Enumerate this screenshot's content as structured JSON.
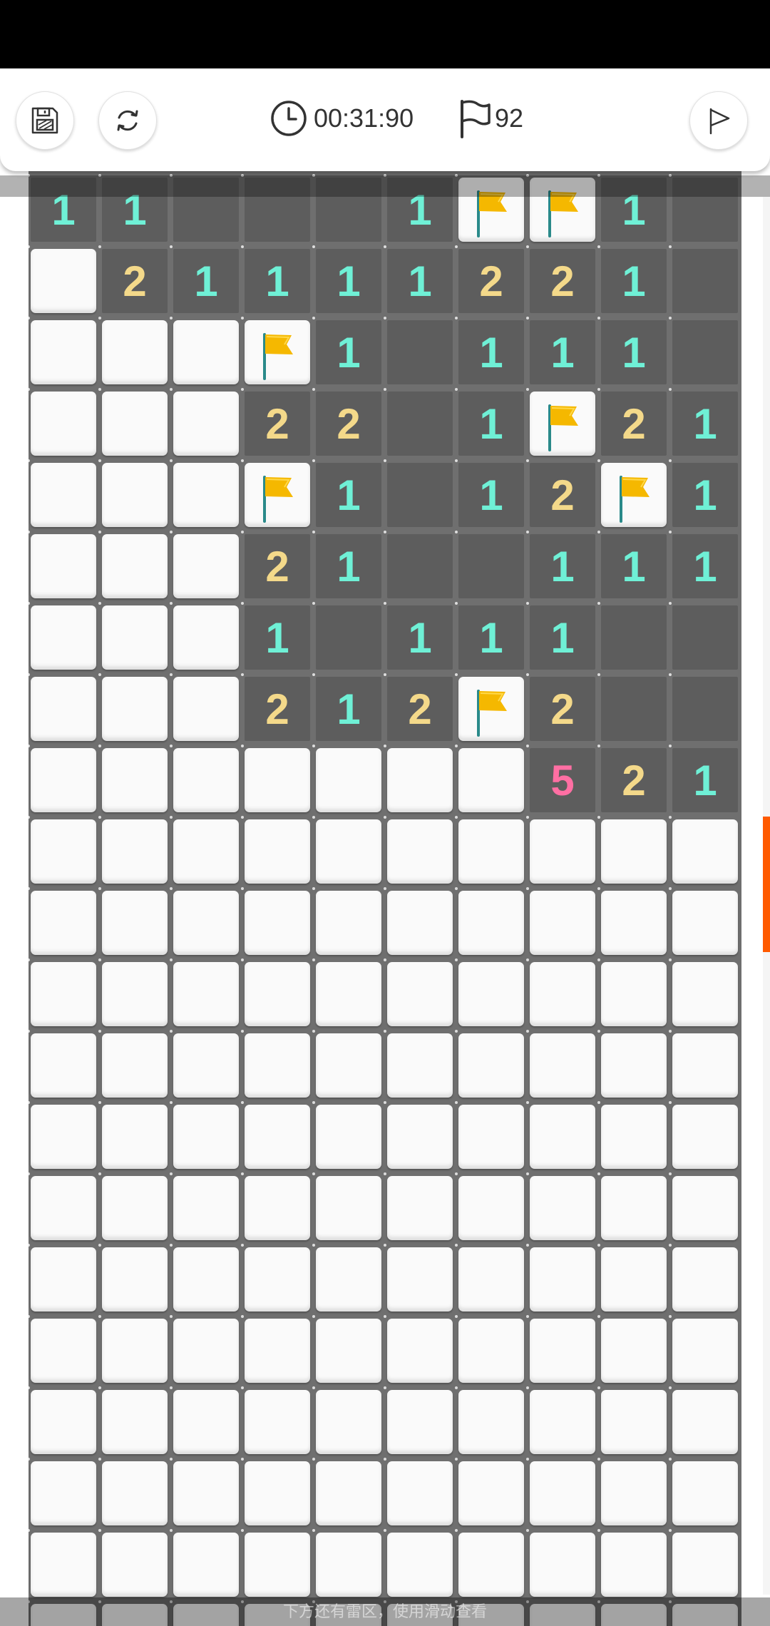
{
  "toolbar": {
    "timer": "00:31:90",
    "flags_remaining": "92"
  },
  "icons": {
    "save": "save-icon",
    "restart": "refresh-icon",
    "clock": "clock-icon",
    "flag_counter": "flag-outline-icon",
    "flag_mode": "flag-mode-icon"
  },
  "colors": {
    "number_1": "#6ff0d6",
    "number_2": "#f4d98a",
    "number_5": "#ff6fa3",
    "flag": "#f5b800",
    "scroll_indicator": "#ff5a00"
  },
  "board": {
    "columns": 10,
    "legend": "U = unopened, E = opened empty, F = flagged, digit = opened with count",
    "rows": [
      "11EEE1FF1E",
      "U21111221E",
      "UUUF1E111E",
      "UUU22E1F21",
      "UUUF1E12F1",
      "UUU21EE111",
      "UUU1E111EE",
      "UUU212F2EE",
      "UUUUUUU521",
      "UUUUUUUUUU",
      "UUUUUUUUUU",
      "UUUUUUUUUU",
      "UUUUUUUUUU",
      "UUUUUUUUUU",
      "UUUUUUUUUU",
      "UUUUUUUUUU",
      "UUUUUUUUUU",
      "UUUUUUUUUU",
      "UUUUUUUUUU",
      "UUUUUUUUUU",
      "UUUUUUUUUU"
    ]
  },
  "footer": {
    "hint": "下方还有雷区，使用滑动查看"
  }
}
